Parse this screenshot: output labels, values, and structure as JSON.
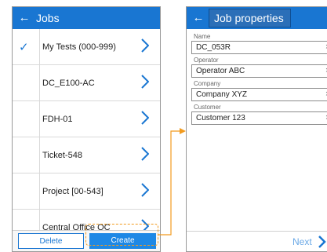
{
  "left_screen": {
    "title": "Jobs",
    "back_icon": "←",
    "check_icon": "✓",
    "jobs": [
      {
        "label": "My Tests (000-999)",
        "selected": true
      },
      {
        "label": "DC_E100-AC",
        "selected": false
      },
      {
        "label": "FDH-01",
        "selected": false
      },
      {
        "label": "Ticket-548",
        "selected": false
      },
      {
        "label": "Project [00-543]",
        "selected": false
      },
      {
        "label": "Central Office QC",
        "selected": false
      }
    ],
    "buttons": {
      "delete": "Delete",
      "create": "Create"
    }
  },
  "right_screen": {
    "title": "Job properties",
    "back_icon": "←",
    "clear_icon": "×",
    "fields": [
      {
        "label": "Name",
        "value": "DC_053R"
      },
      {
        "label": "Operator",
        "value": "Operator ABC"
      },
      {
        "label": "Company",
        "value": "Company XYZ"
      },
      {
        "label": "Customer",
        "value": "Customer 123"
      }
    ],
    "next_label": "Next"
  },
  "colors": {
    "appbar": "#1976d2",
    "accent": "#1e88e5",
    "highlight": "#f29b1f",
    "next_text": "#6aa8e6"
  }
}
